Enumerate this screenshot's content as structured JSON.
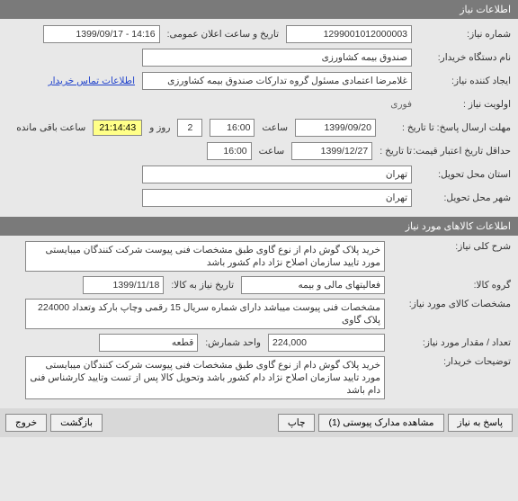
{
  "section1": {
    "title": "اطلاعات نیاز"
  },
  "need_number": {
    "label": "شماره نیاز:",
    "value": "1299001012000003",
    "announce_label": "تاریخ و ساعت اعلان عمومی:",
    "announce_value": "14:16 - 1399/09/17"
  },
  "buyer_org": {
    "label": "نام دستگاه خریدار:",
    "value": "صندوق بیمه  کشاورزی"
  },
  "creator": {
    "label": "ایجاد کننده نیاز:",
    "value": "غلامرضا اعتمادی مسئول گروه تدارکات صندوق بیمه  کشاورزی",
    "contact_link": "اطلاعات تماس خریدار"
  },
  "priority": {
    "label": "اولویت نیاز :",
    "value": "فوری"
  },
  "response_deadline": {
    "label": "مهلت ارسال پاسخ:  تا تاریخ :",
    "date": "1399/09/20",
    "time_label": "ساعت",
    "time": "16:00",
    "days": "2",
    "days_label": "روز و",
    "remain": "21:14:43",
    "remain_label": "ساعت باقی مانده"
  },
  "min_validity": {
    "label": "حداقل تاریخ اعتبار قیمت:",
    "to_label": "تا تاریخ :",
    "date": "1399/12/27",
    "time_label": "ساعت",
    "time": "16:00"
  },
  "delivery_province": {
    "label": "استان محل تحویل:",
    "value": "تهران"
  },
  "delivery_city": {
    "label": "شهر محل تحویل:",
    "value": "تهران"
  },
  "section2": {
    "title": "اطلاعات کالاهای مورد نیاز"
  },
  "general_desc": {
    "label": "شرح کلی نیاز:",
    "value": "خرید پلاک گوش دام از نوع گاوی طبق مشخصات فنی پیوست شرکت کنندگان میبایستی مورد تایید سازمان اصلاح نژاد دام کشور باشد"
  },
  "goods_group": {
    "label": "گروه کالا:",
    "value": "فعالیتهای مالی و بیمه",
    "expire_label": "تاریخ نیاز به کالا:",
    "expire_value": "1399/11/18"
  },
  "goods_spec": {
    "label": "مشخصات کالای مورد نیاز:",
    "value": "مشخصات فنی پیوست میباشد دارای شماره سریال 15 رقمی وچاپ بارکد وتعداد 224000 پلاک گاوی"
  },
  "quantity": {
    "label": "تعداد / مقدار مورد نیاز:",
    "value": "224,000",
    "unit_label": "واحد شمارش:",
    "unit_value": "قطعه"
  },
  "buyer_notes": {
    "label": "توضیحات خریدار:",
    "value": "خرید پلاک گوش دام از نوع گاوی طبق مشخصات فنی پیوست شرکت کنندگان میبایستی مورد تایید سازمان اصلاح نژاد دام کشور باشد وتحویل کالا پس از تست وتایید کارشناس فنی دام باشد"
  },
  "footer": {
    "respond": "پاسخ به نیاز",
    "attachments": "مشاهده مدارک پیوستی  (1)",
    "print": "چاپ",
    "back": "بازگشت",
    "exit": "خروج"
  }
}
